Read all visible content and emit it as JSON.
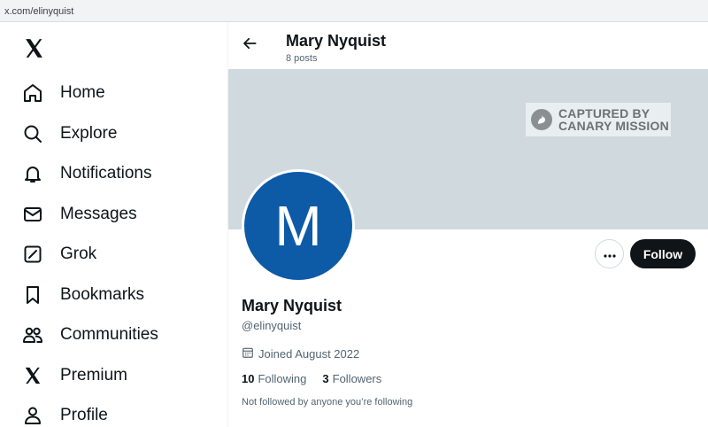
{
  "browser": {
    "url": "x.com/elinyquist"
  },
  "sidebar": {
    "logo_icon": "x-logo-icon",
    "items": [
      {
        "label": "Home",
        "icon": "home-icon"
      },
      {
        "label": "Explore",
        "icon": "search-icon"
      },
      {
        "label": "Notifications",
        "icon": "bell-icon"
      },
      {
        "label": "Messages",
        "icon": "envelope-icon"
      },
      {
        "label": "Grok",
        "icon": "grok-icon"
      },
      {
        "label": "Bookmarks",
        "icon": "bookmark-icon"
      },
      {
        "label": "Communities",
        "icon": "people-icon"
      },
      {
        "label": "Premium",
        "icon": "x-logo-icon"
      },
      {
        "label": "Profile",
        "icon": "person-icon"
      }
    ]
  },
  "header": {
    "title": "Mary Nyquist",
    "post_count": "8 posts"
  },
  "banner": {
    "watermark_line1": "CAPTURED BY",
    "watermark_line2": "CANARY MISSION"
  },
  "profile": {
    "avatar_letter": "M",
    "avatar_color": "#0d5aa7",
    "name": "Mary Nyquist",
    "handle": "@elinyquist",
    "joined": "Joined August 2022",
    "following_count": "10",
    "following_label": "Following",
    "followers_count": "3",
    "followers_label": "Followers",
    "followed_by": "Not followed by anyone you’re following"
  },
  "actions": {
    "more_label": "•••",
    "follow_label": "Follow"
  }
}
